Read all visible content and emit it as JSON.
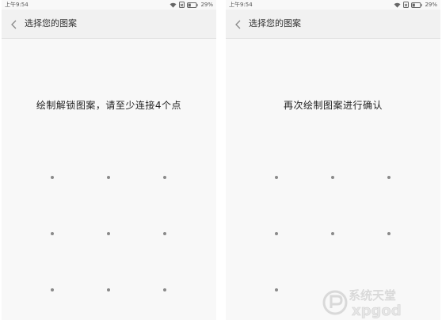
{
  "screens": [
    {
      "status": {
        "time": "上午9:54",
        "battery": "29%"
      },
      "title": "选择您的图案",
      "prompt": "绘制解锁图案，请至少连接4个点"
    },
    {
      "status": {
        "time": "上午9:54",
        "battery": "29%"
      },
      "title": "选择您的图案",
      "prompt": "再次绘制图案进行确认"
    }
  ],
  "watermark": {
    "text": "系统天堂",
    "subtext": "xpgod"
  },
  "colors": {
    "background": "#f8f8f8",
    "titlebar": "#f1f1f1",
    "dot": "#8a8a8a",
    "text": "#222222"
  },
  "icons": [
    "back-icon",
    "wifi-icon",
    "sim-icon",
    "battery-icon"
  ]
}
